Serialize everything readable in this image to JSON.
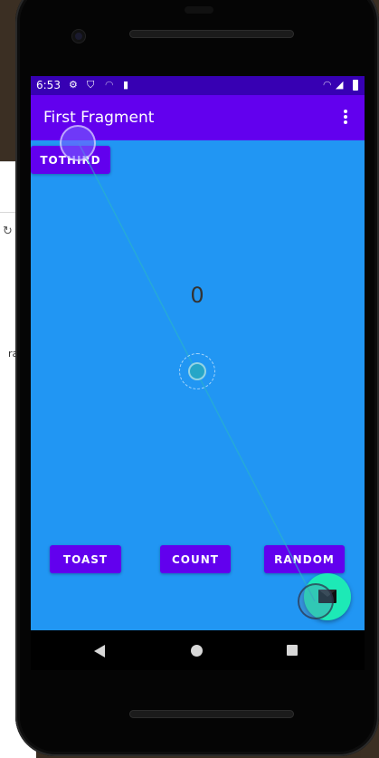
{
  "status_bar": {
    "time": "6:53",
    "icons": [
      "gear-icon",
      "shield-icon",
      "wifi-off-icon",
      "sd-card-icon",
      "wifi-icon",
      "signal-icon",
      "battery-icon"
    ]
  },
  "app_bar": {
    "title": "First Fragment",
    "overflow_icon": "more-vert-icon"
  },
  "buttons": {
    "tothird": "TOTHIRD",
    "toast": "TOAST",
    "count": "COUNT",
    "random": "RANDOM"
  },
  "counter": {
    "value": "0"
  },
  "fab": {
    "icon": "mail-icon",
    "color": "#1de9b6"
  },
  "background_page": {
    "partial_text": "ra"
  },
  "nav_bar": {
    "icons": [
      "back-icon",
      "home-icon",
      "recents-icon"
    ]
  },
  "colors": {
    "primary": "#6200ee",
    "primary_dark": "#3700b3",
    "screen_background": "#2196f3",
    "accent": "#1de9b6"
  }
}
